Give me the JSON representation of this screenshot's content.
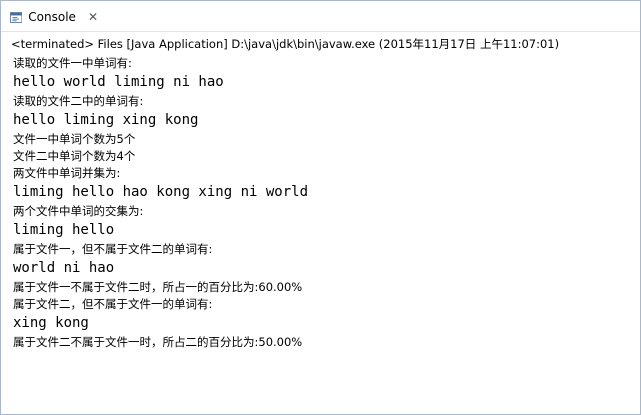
{
  "tab": {
    "label": "Console",
    "close_symbol": "✕",
    "icon": "console-icon"
  },
  "status": {
    "text": "<terminated> Files [Java Application] D:\\java\\jdk\\bin\\javaw.exe (2015年11月17日 上午11:07:01)"
  },
  "console": {
    "lines": [
      {
        "kind": "cn",
        "text": "读取的文件一中单词有:"
      },
      {
        "kind": "en",
        "text": "hello world liming ni hao"
      },
      {
        "kind": "cn",
        "text": "读取的文件二中的单词有:"
      },
      {
        "kind": "en",
        "text": "hello liming xing kong"
      },
      {
        "kind": "cn",
        "text": "文件一中单词个数为5个"
      },
      {
        "kind": "cn",
        "text": "文件二中单词个数为4个"
      },
      {
        "kind": "cn",
        "text": "两文件中单词并集为:"
      },
      {
        "kind": "en",
        "text": "liming hello hao kong xing ni world"
      },
      {
        "kind": "cn",
        "text": "两个文件中单词的交集为:"
      },
      {
        "kind": "en",
        "text": "liming hello"
      },
      {
        "kind": "cn",
        "text": "属于文件一，但不属于文件二的单词有:"
      },
      {
        "kind": "en",
        "text": "world ni hao"
      },
      {
        "kind": "cn",
        "text": "属于文件一不属于文件二时，所占一的百分比为:60.00%"
      },
      {
        "kind": "cn",
        "text": "属于文件二，但不属于文件一的单词有:"
      },
      {
        "kind": "en",
        "text": "xing kong"
      },
      {
        "kind": "cn",
        "text": "属于文件二不属于文件一时，所占二的百分比为:50.00%"
      }
    ]
  },
  "colors": {
    "border": "#a9b7c9",
    "text": "#000000",
    "background": "#ffffff"
  }
}
